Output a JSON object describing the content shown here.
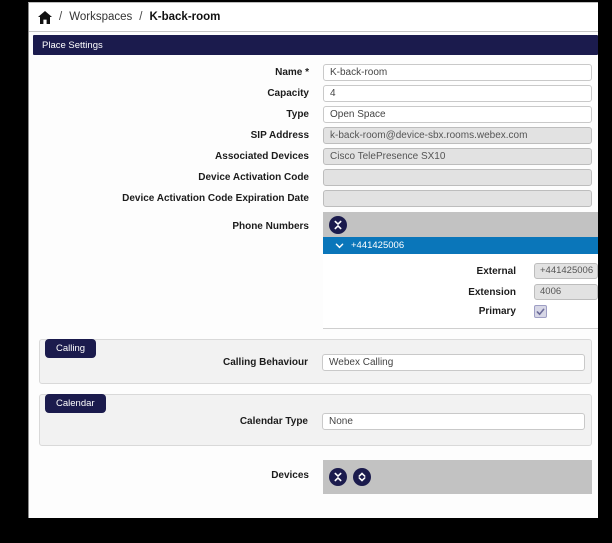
{
  "breadcrumb": {
    "separator": "/",
    "workspaces": "Workspaces",
    "current": "K-back-room"
  },
  "tabs": {
    "place_settings": "Place Settings"
  },
  "form": {
    "fields": [
      {
        "label": "Name *",
        "value": "K-back-room"
      },
      {
        "label": "Capacity",
        "value": "4"
      },
      {
        "label": "Type",
        "value": "Open Space"
      },
      {
        "label": "SIP Address",
        "value": "k-back-room@device-sbx.rooms.webex.com"
      },
      {
        "label": "Associated Devices",
        "value": "Cisco TelePresence SX10"
      },
      {
        "label": "Device Activation Code",
        "value": ""
      },
      {
        "label": "Device Activation Code Expiration Date",
        "value": ""
      }
    ],
    "phone": {
      "label": "Phone Numbers",
      "number": "+441425006",
      "external_label": "External",
      "external_value": "+441425006",
      "extension_label": "Extension",
      "extension_value": "4006",
      "primary_label": "Primary",
      "primary_checked": "true"
    }
  },
  "calling": {
    "tab": "Calling",
    "label": "Calling Behaviour",
    "value": "Webex Calling"
  },
  "calendar": {
    "tab": "Calendar",
    "label": "Calendar Type",
    "value": "None"
  },
  "devices": {
    "label": "Devices"
  },
  "colors": {
    "navy": "#1b1b4d",
    "blue": "#0a76ba",
    "band_grey": "#c2c2c2"
  }
}
